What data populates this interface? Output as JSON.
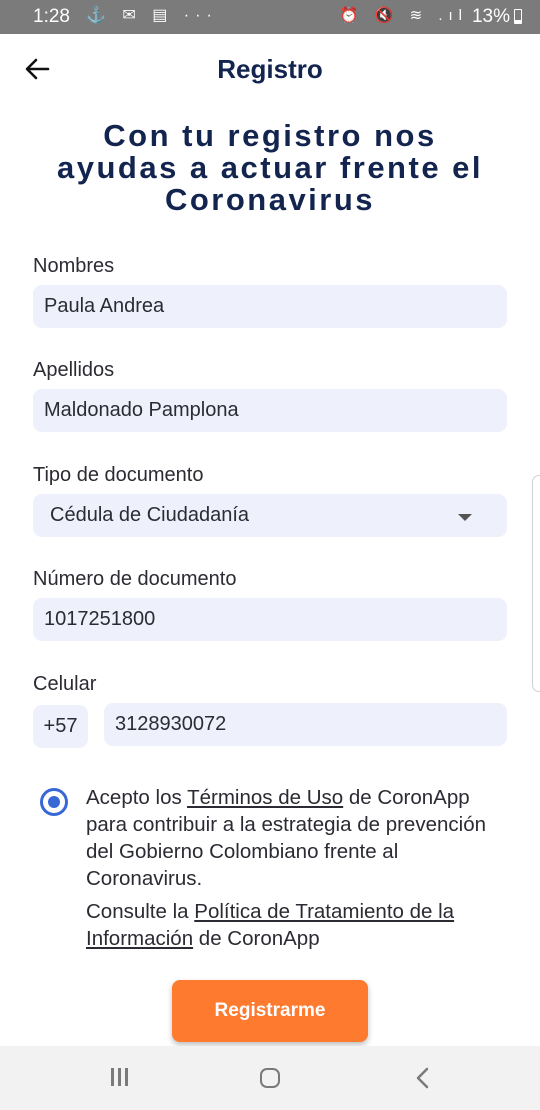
{
  "status_bar": {
    "time": "1:28",
    "left_icons": "⚓ ✉ ▤ ···",
    "right_icons": "⏰ 🔇 ≋ .ıl",
    "battery": "13%"
  },
  "header": {
    "title": "Registro",
    "back_icon": "arrow-left-icon"
  },
  "headline": "Con tu registro nos ayudas a actuar frente el Coronavirus",
  "form": {
    "nombres": {
      "label": "Nombres",
      "value": "Paula Andrea"
    },
    "apellidos": {
      "label": "Apellidos",
      "value": "Maldonado Pamplona"
    },
    "tipo_documento": {
      "label": "Tipo de documento",
      "value": "Cédula de Ciudadanía"
    },
    "numero_documento": {
      "label": "Número de documento",
      "value": "1017251800"
    },
    "celular": {
      "label": "Celular",
      "prefix": "+57",
      "value": "3128930072"
    }
  },
  "terms": {
    "text_1": "Acepto los ",
    "link_terms": "Términos de Uso",
    "text_2": " de CoronApp para contribuir a la estrategia de prevención del Gobierno Colombiano frente al Coronavirus.",
    "text_3": "Consulte la ",
    "link_policy": "Política de Tratamiento de la Información",
    "text_4": " de CoronApp",
    "accepted": true
  },
  "register_button": "Registrarme",
  "colors": {
    "primary_text": "#13254f",
    "input_bg": "#eef0fc",
    "accent_orange": "#fd7a2f",
    "radio_blue": "#3867d6"
  }
}
